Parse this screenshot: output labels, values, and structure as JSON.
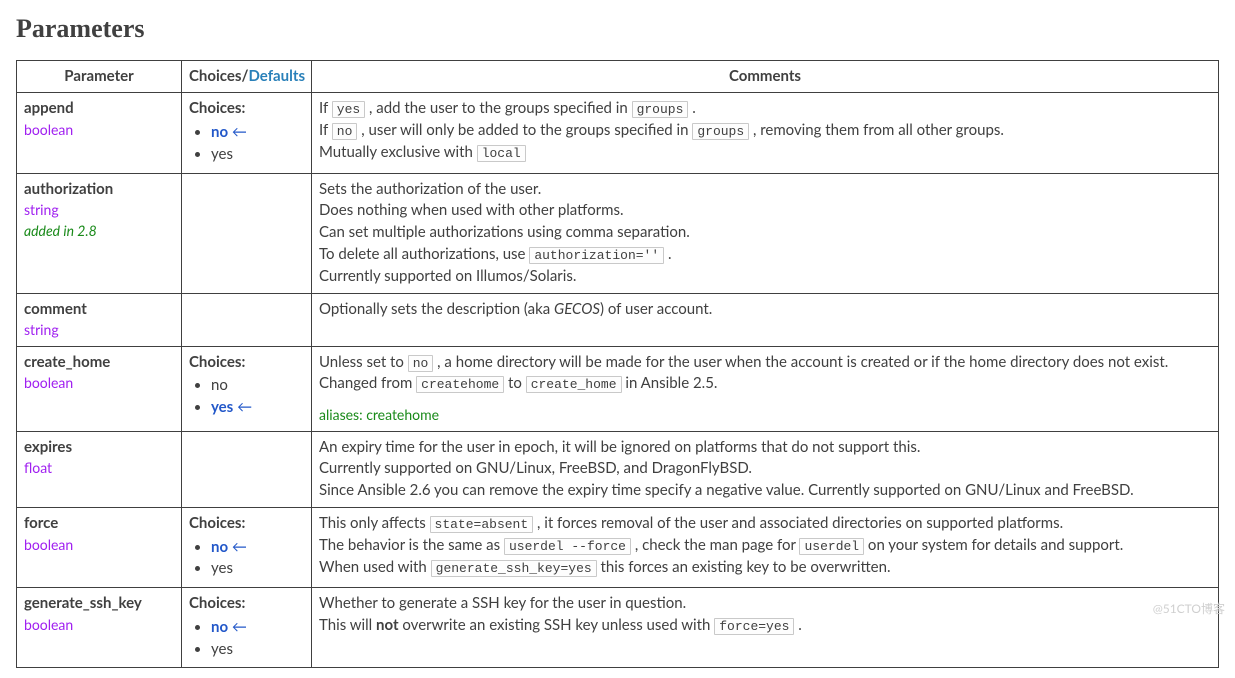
{
  "heading": "Parameters",
  "headers": {
    "parameter": "Parameter",
    "choices_prefix": "Choices/",
    "defaults": "Defaults",
    "comments": "Comments"
  },
  "labels": {
    "choices": "Choices:",
    "arrow": "←",
    "aliases_prefix": "aliases: "
  },
  "types": {
    "boolean": "boolean",
    "string": "string",
    "float": "float"
  },
  "rows": {
    "append": {
      "name": "append",
      "type": "boolean",
      "choices": {
        "no": "no",
        "yes": "yes"
      },
      "c1a": "If ",
      "c1b": "yes",
      "c1c": " , add the user to the groups specified in ",
      "c1d": "groups",
      "c1e": " .",
      "c2a": "If ",
      "c2b": "no",
      "c2c": " , user will only be added to the groups specified in ",
      "c2d": "groups",
      "c2e": " , removing them from all other groups.",
      "c3a": "Mutually exclusive with ",
      "c3b": "local"
    },
    "authorization": {
      "name": "authorization",
      "type": "string",
      "added": "added in 2.8",
      "c1": "Sets the authorization of the user.",
      "c2": "Does nothing when used with other platforms.",
      "c3": "Can set multiple authorizations using comma separation.",
      "c4a": "To delete all authorizations, use ",
      "c4b": "authorization=''",
      "c4c": " .",
      "c5": "Currently supported on Illumos/Solaris."
    },
    "comment": {
      "name": "comment",
      "type": "string",
      "c1a": "Optionally sets the description (aka ",
      "c1b": "GECOS",
      "c1c": ") of user account."
    },
    "create_home": {
      "name": "create_home",
      "type": "boolean",
      "choices": {
        "no": "no",
        "yes": "yes"
      },
      "c1a": "Unless set to ",
      "c1b": "no",
      "c1c": " , a home directory will be made for the user when the account is created or if the home directory does not exist.",
      "c2a": "Changed from ",
      "c2b": "createhome",
      "c2c": " to ",
      "c2d": "create_home",
      "c2e": " in Ansible 2.5.",
      "aliases": "createhome"
    },
    "expires": {
      "name": "expires",
      "type": "float",
      "c1": "An expiry time for the user in epoch, it will be ignored on platforms that do not support this.",
      "c2": "Currently supported on GNU/Linux, FreeBSD, and DragonFlyBSD.",
      "c3": "Since Ansible 2.6 you can remove the expiry time specify a negative value. Currently supported on GNU/Linux and FreeBSD."
    },
    "force": {
      "name": "force",
      "type": "boolean",
      "choices": {
        "no": "no",
        "yes": "yes"
      },
      "c1a": "This only affects ",
      "c1b": "state=absent",
      "c1c": " , it forces removal of the user and associated directories on supported platforms.",
      "c2a": "The behavior is the same as ",
      "c2b": "userdel --force",
      "c2c": " , check the man page for ",
      "c2d": "userdel",
      "c2e": " on your system for details and support.",
      "c3a": "When used with ",
      "c3b": "generate_ssh_key=yes",
      "c3c": " this forces an existing key to be overwritten."
    },
    "generate_ssh_key": {
      "name": "generate_ssh_key",
      "type": "boolean",
      "choices": {
        "no": "no",
        "yes": "yes"
      },
      "c1": "Whether to generate a SSH key for the user in question.",
      "c2a": "This will ",
      "c2b": "not",
      "c2c": " overwrite an existing SSH key unless used with ",
      "c2d": "force=yes",
      "c2e": " ."
    }
  },
  "watermark": "@51CTO博客"
}
